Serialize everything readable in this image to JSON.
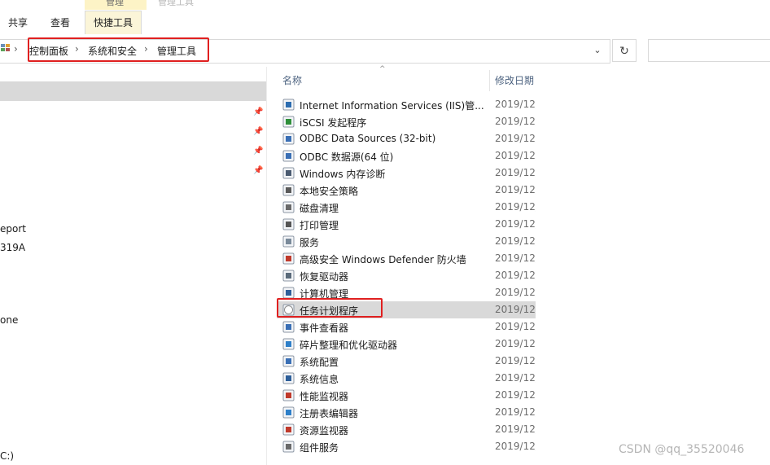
{
  "ribbon": {
    "context_label_top": "管理",
    "context_label_faded": "管理工具",
    "tabs": [
      {
        "label": "共享"
      },
      {
        "label": "查看"
      },
      {
        "label": "快捷工具"
      }
    ]
  },
  "address": {
    "crumbs": [
      "控制面板",
      "系统和安全",
      "管理工具"
    ],
    "separator": "›",
    "dropdown_glyph": "⌄",
    "refresh_glyph": "↻",
    "search_placeholder": ""
  },
  "nav": {
    "pin_glyph": "📌",
    "texts": [
      "eport",
      "319A",
      "one",
      "C:)"
    ]
  },
  "list": {
    "sort_glyph": "^",
    "col_name": "名称",
    "col_date": "修改日期",
    "items": [
      {
        "name": "Internet Information Services (IIS)管...",
        "date": "2019/12/",
        "icon": "iis-manager-icon",
        "color": "#2b6cb0"
      },
      {
        "name": "iSCSI 发起程序",
        "date": "2019/12/",
        "icon": "iscsi-globe-icon",
        "color": "#2f8f3a"
      },
      {
        "name": "ODBC Data Sources (32-bit)",
        "date": "2019/12/",
        "icon": "odbc-icon",
        "color": "#3a6fb5"
      },
      {
        "name": "ODBC 数据源(64 位)",
        "date": "2019/12/",
        "icon": "odbc-icon",
        "color": "#3a6fb5"
      },
      {
        "name": "Windows 内存诊断",
        "date": "2019/12/",
        "icon": "memory-diagnostic-icon",
        "color": "#4a5a70"
      },
      {
        "name": "本地安全策略",
        "date": "2019/12/",
        "icon": "security-policy-icon",
        "color": "#5a5a5a"
      },
      {
        "name": "磁盘清理",
        "date": "2019/12/",
        "icon": "disk-cleanup-icon",
        "color": "#6a6a6a"
      },
      {
        "name": "打印管理",
        "date": "2019/12/",
        "icon": "print-management-icon",
        "color": "#555555"
      },
      {
        "name": "服务",
        "date": "2019/12/",
        "icon": "services-gear-icon",
        "color": "#7a8a9a"
      },
      {
        "name": "高级安全 Windows Defender 防火墙",
        "date": "2019/12/",
        "icon": "firewall-icon",
        "color": "#c0392b"
      },
      {
        "name": "恢复驱动器",
        "date": "2019/12/",
        "icon": "recovery-drive-icon",
        "color": "#5a6a7a"
      },
      {
        "name": "计算机管理",
        "date": "2019/12/",
        "icon": "computer-management-icon",
        "color": "#2d5f9a"
      },
      {
        "name": "任务计划程序",
        "date": "2019/12/",
        "icon": "task-scheduler-clock-icon",
        "color": "#8a8a8a"
      },
      {
        "name": "事件查看器",
        "date": "2019/12/",
        "icon": "event-viewer-icon",
        "color": "#3a6fb5"
      },
      {
        "name": "碎片整理和优化驱动器",
        "date": "2019/12/",
        "icon": "defrag-icon",
        "color": "#2d7fc9"
      },
      {
        "name": "系统配置",
        "date": "2019/12/",
        "icon": "system-config-icon",
        "color": "#3a6fb5"
      },
      {
        "name": "系统信息",
        "date": "2019/12/",
        "icon": "system-info-icon",
        "color": "#2d5f9a"
      },
      {
        "name": "性能监视器",
        "date": "2019/12/",
        "icon": "performance-monitor-icon",
        "color": "#c0392b"
      },
      {
        "name": "注册表编辑器",
        "date": "2019/12/",
        "icon": "registry-editor-icon",
        "color": "#2d7fc9"
      },
      {
        "name": "资源监视器",
        "date": "2019/12/",
        "icon": "resource-monitor-icon",
        "color": "#c0392b"
      },
      {
        "name": "组件服务",
        "date": "2019/12/",
        "icon": "component-services-icon",
        "color": "#6a6a6a"
      }
    ]
  },
  "watermark": "CSDN @qq_35520046"
}
